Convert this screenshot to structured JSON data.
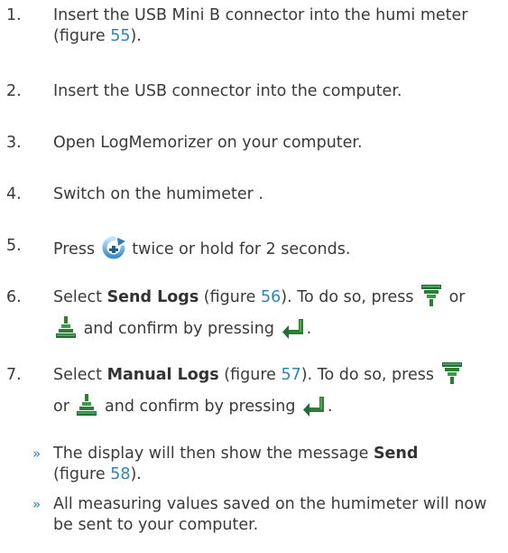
{
  "steps": [
    {
      "num": "1.",
      "text": "Insert the USB Mini B connector into the humi meter  (figure ",
      "fig": "55",
      "after": ")."
    },
    {
      "num": "2.",
      "text": "Insert the USB connector into the computer."
    },
    {
      "num": "3.",
      "text": "Open LogMemorizer on your computer."
    },
    {
      "num": "4.",
      "text": "Switch on the humimeter ."
    },
    {
      "num": "5.",
      "pre": "Press ",
      "post": " twice or hold for 2 seconds.",
      "icon": "timer-rotate-icon"
    },
    {
      "num": "6.",
      "pre": "Select ",
      "bold": "Send Logs",
      "mid": " (figure ",
      "fig": "56",
      "post1": "). To do so, press ",
      "or": " or",
      "confirm": " and confirm by pressing ",
      "end": "."
    },
    {
      "num": "7.",
      "pre": "Select ",
      "bold": "Manual Logs",
      "mid": " (figure ",
      "fig": "57",
      "post1": "). To do so, press ",
      "or": "or ",
      "confirm": " and confirm by pressing ",
      "end": "."
    }
  ],
  "results": [
    {
      "marker": "»",
      "pre": "The display will then show the message ",
      "bold": "Send",
      "mid": "(figure ",
      "fig": "58",
      "end": ")."
    },
    {
      "marker": "»",
      "text": "All measuring values saved on the humimeter  will now be sent to your computer."
    }
  ],
  "icons": [
    "arrow-down-key-icon",
    "arrow-up-key-icon",
    "enter-key-icon",
    "timer-rotate-icon"
  ],
  "colors": {
    "text": "#3a3a3a",
    "link": "#2a86b8",
    "icon_blue": "#3a8fc8",
    "icon_green": "#2e7d32"
  }
}
